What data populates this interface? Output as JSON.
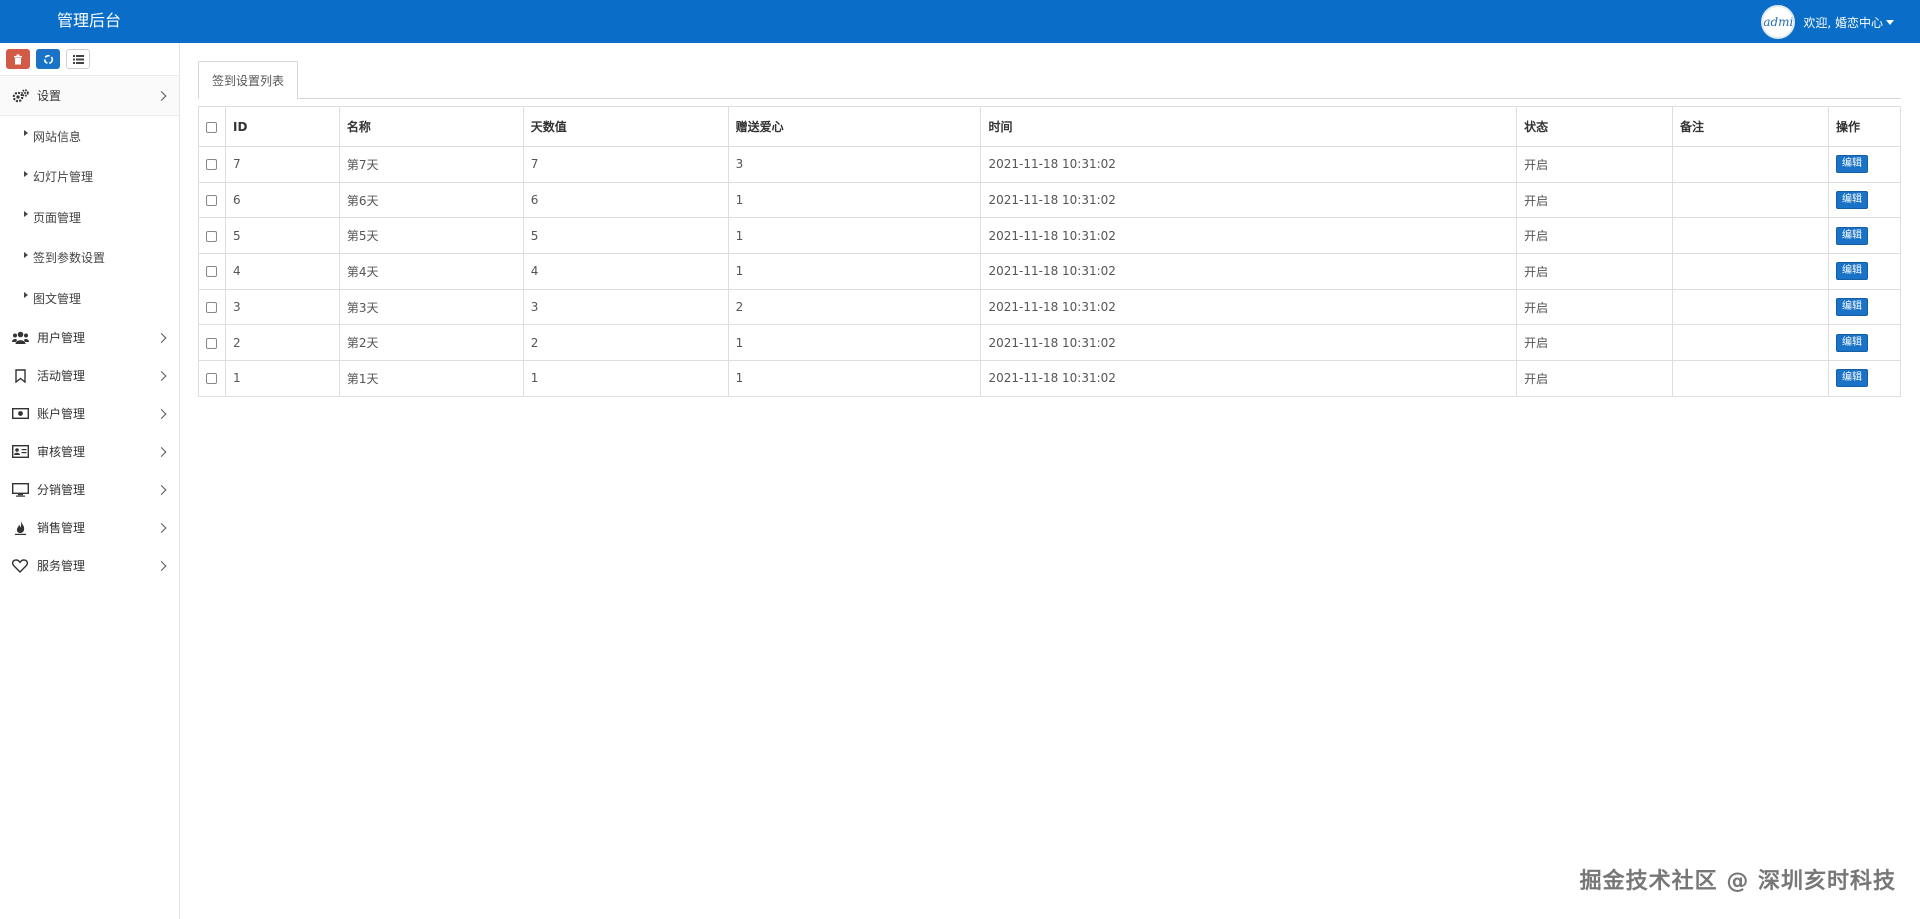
{
  "header": {
    "brand": "管理后台",
    "avatar_text": "admi",
    "welcome": "欢迎, 婚恋中心"
  },
  "sidebar": {
    "shortcuts": [
      {
        "icon": "trash-icon",
        "color": "#d15b47"
      },
      {
        "icon": "recycle-icon",
        "color": "#1a73c6"
      },
      {
        "icon": "list-icon",
        "color": "#ffffff"
      }
    ],
    "settings": {
      "label": "设置",
      "icon": "gears-icon",
      "children": [
        "网站信息",
        "幻灯片管理",
        "页面管理",
        "签到参数设置",
        "图文管理"
      ]
    },
    "menu": [
      {
        "label": "用户管理",
        "icon": "users-icon"
      },
      {
        "label": "活动管理",
        "icon": "bookmark-icon"
      },
      {
        "label": "账户管理",
        "icon": "money-icon"
      },
      {
        "label": "审核管理",
        "icon": "id-card-icon"
      },
      {
        "label": "分销管理",
        "icon": "monitor-icon"
      },
      {
        "label": "销售管理",
        "icon": "fire-icon"
      },
      {
        "label": "服务管理",
        "icon": "heart-icon"
      }
    ]
  },
  "main": {
    "tab": "签到设置列表",
    "columns": [
      "ID",
      "名称",
      "天数值",
      "赠送爱心",
      "时间",
      "状态",
      "备注",
      "操作"
    ],
    "rows": [
      {
        "id": "7",
        "name": "第7天",
        "days": "7",
        "hearts": "3",
        "time": "2021-11-18 10:31:02",
        "status": "开启",
        "note": "",
        "action": "编辑"
      },
      {
        "id": "6",
        "name": "第6天",
        "days": "6",
        "hearts": "1",
        "time": "2021-11-18 10:31:02",
        "status": "开启",
        "note": "",
        "action": "编辑"
      },
      {
        "id": "5",
        "name": "第5天",
        "days": "5",
        "hearts": "1",
        "time": "2021-11-18 10:31:02",
        "status": "开启",
        "note": "",
        "action": "编辑"
      },
      {
        "id": "4",
        "name": "第4天",
        "days": "4",
        "hearts": "1",
        "time": "2021-11-18 10:31:02",
        "status": "开启",
        "note": "",
        "action": "编辑"
      },
      {
        "id": "3",
        "name": "第3天",
        "days": "3",
        "hearts": "2",
        "time": "2021-11-18 10:31:02",
        "status": "开启",
        "note": "",
        "action": "编辑"
      },
      {
        "id": "2",
        "name": "第2天",
        "days": "2",
        "hearts": "1",
        "time": "2021-11-18 10:31:02",
        "status": "开启",
        "note": "",
        "action": "编辑"
      },
      {
        "id": "1",
        "name": "第1天",
        "days": "1",
        "hearts": "1",
        "time": "2021-11-18 10:31:02",
        "status": "开启",
        "note": "",
        "action": "编辑"
      }
    ]
  },
  "watermark": "掘金技术社区 @ 深圳亥时科技",
  "colors": {
    "navbar": "#0a6ec8",
    "status_on": "#2e8b2e",
    "edit_button": "#1a73c6"
  }
}
